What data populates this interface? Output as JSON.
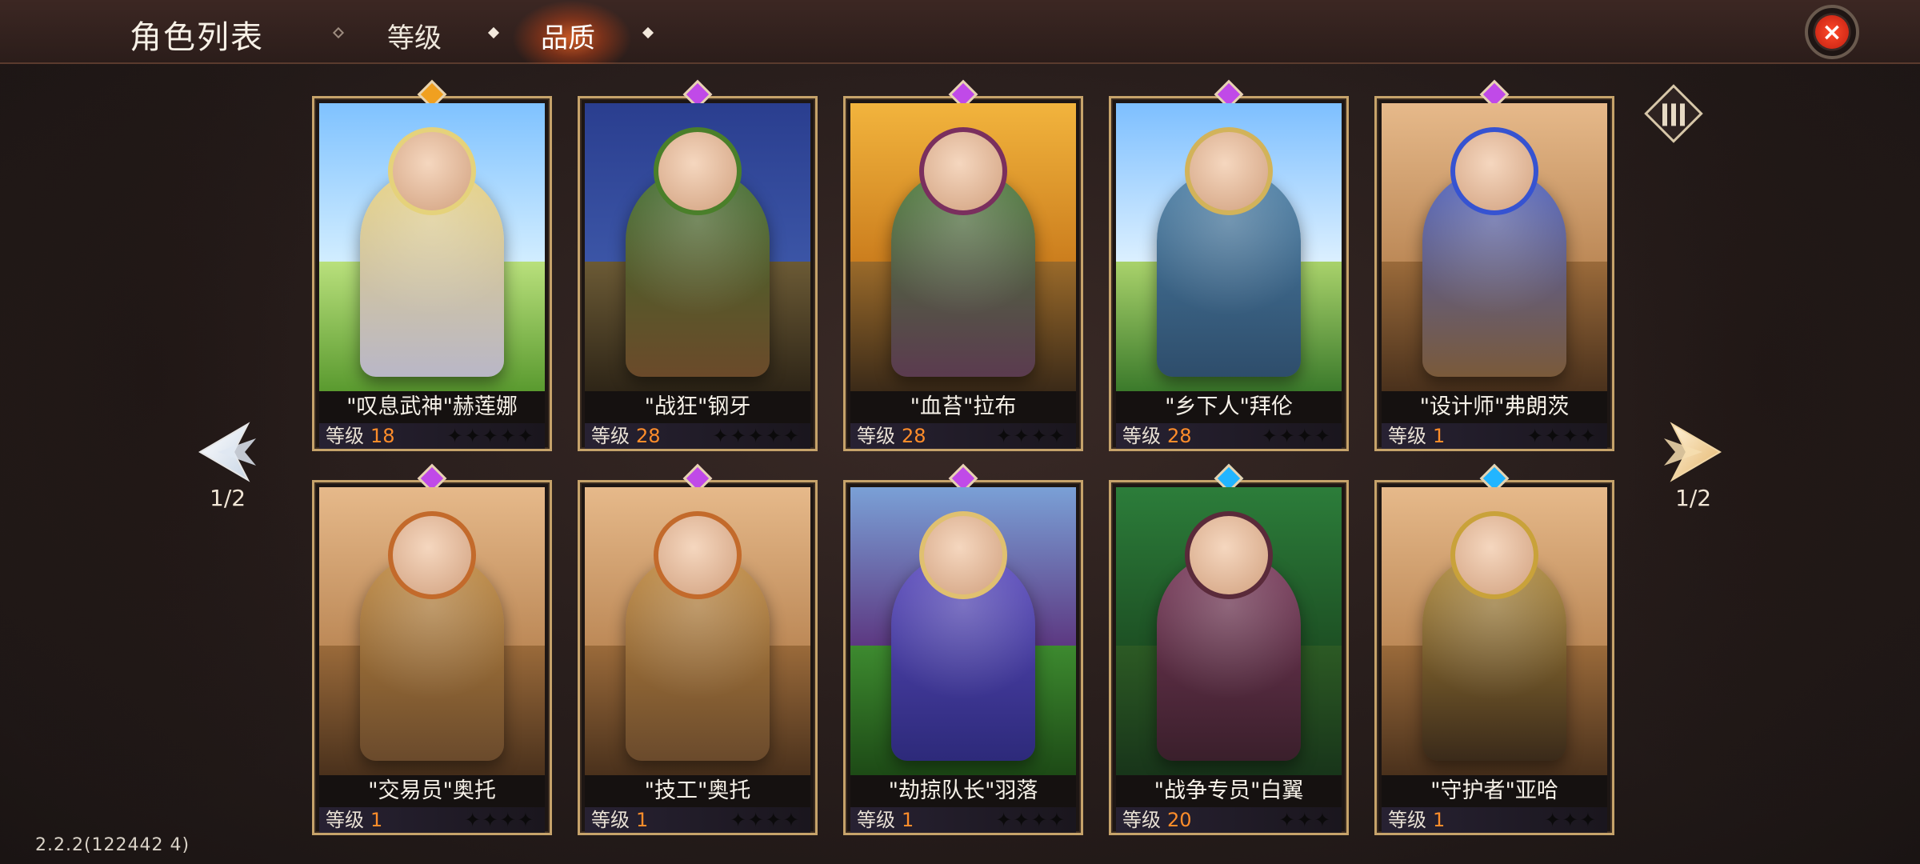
{
  "header": {
    "title": "角色列表",
    "tabs": [
      {
        "label": "等级"
      },
      {
        "label": "品质"
      }
    ]
  },
  "pagination": {
    "left_label": "1/2",
    "right_label": "1/2"
  },
  "colors": {
    "accent_orange": "#ff8d2a",
    "gem_gold": "#f0a020",
    "gem_purple": "#c04ae8",
    "gem_blue": "#22b5ff",
    "card_border": "#c6a36a"
  },
  "cards": [
    {
      "name": "\"叹息武神\"赫莲娜",
      "level_label": "等级",
      "level": "18",
      "stars": "✦✦✦✦✦"
    },
    {
      "name": "\"战狂\"钢牙",
      "level_label": "等级",
      "level": "28",
      "stars": "✦✦✦✦✦"
    },
    {
      "name": "\"血苔\"拉布",
      "level_label": "等级",
      "level": "28",
      "stars": "✦✦✦✦"
    },
    {
      "name": "\"乡下人\"拜伦",
      "level_label": "等级",
      "level": "28",
      "stars": "✦✦✦✦"
    },
    {
      "name": "\"设计师\"弗朗茨",
      "level_label": "等级",
      "level": "1",
      "stars": "✦✦✦✦"
    },
    {
      "name": "\"交易员\"奥托",
      "level_label": "等级",
      "level": "1",
      "stars": "✦✦✦✦"
    },
    {
      "name": "\"技工\"奥托",
      "level_label": "等级",
      "level": "1",
      "stars": "✦✦✦✦"
    },
    {
      "name": "\"劫掠队长\"羽落",
      "level_label": "等级",
      "level": "1",
      "stars": "✦✦✦✦"
    },
    {
      "name": "\"战争专员\"白翼",
      "level_label": "等级",
      "level": "20",
      "stars": "✦✦✦"
    },
    {
      "name": "\"守护者\"亚哈",
      "level_label": "等级",
      "level": "1",
      "stars": "✦✦✦"
    }
  ],
  "footer": {
    "version": "2.2.2(122442 4)"
  }
}
